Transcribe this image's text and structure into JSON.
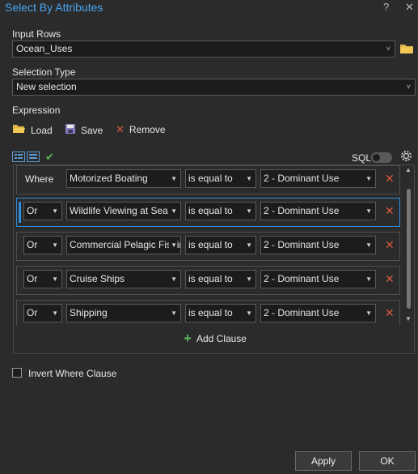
{
  "window": {
    "title": "Select By Attributes",
    "help_glyph": "?",
    "close_glyph": "✕"
  },
  "input_rows": {
    "label": "Input Rows",
    "value": "Ocean_Uses"
  },
  "selection_type": {
    "label": "Selection Type",
    "value": "New selection"
  },
  "expression": {
    "label": "Expression",
    "load_label": "Load",
    "save_label": "Save",
    "remove_label": "Remove",
    "sql_label": "SQL"
  },
  "clauses": [
    {
      "connector": "Where",
      "field": "Motorized Boating",
      "operator": "is equal to",
      "value": "2 - Dominant Use"
    },
    {
      "connector": "Or",
      "field": "Wildlife Viewing at Sea",
      "operator": "is equal to",
      "value": "2 - Dominant Use"
    },
    {
      "connector": "Or",
      "field": "Commercial Pelagic Fishing",
      "operator": "is equal to",
      "value": "2 - Dominant Use"
    },
    {
      "connector": "Or",
      "field": "Cruise Ships",
      "operator": "is equal to",
      "value": "2 - Dominant Use"
    },
    {
      "connector": "Or",
      "field": "Shipping",
      "operator": "is equal to",
      "value": "2 - Dominant Use"
    }
  ],
  "add_clause_label": "Add Clause",
  "invert_label": "Invert Where Clause",
  "apply_label": "Apply",
  "ok_label": "OK",
  "colors": {
    "accent": "#2f8fde",
    "title": "#4aa3ee",
    "delete": "#d9573b",
    "add": "#5cb85c"
  }
}
